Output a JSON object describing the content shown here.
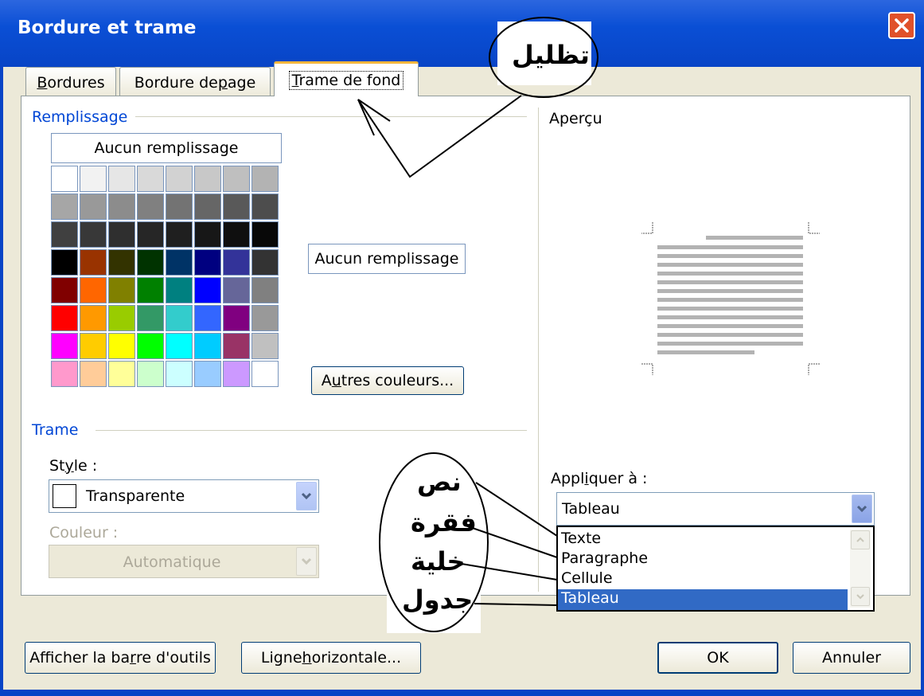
{
  "window": {
    "title": "Bordure et trame",
    "accent": "#0a4fd5",
    "close_color": "#e0512a"
  },
  "tabs": [
    {
      "label": "Bordures",
      "underline": "B",
      "rest": "ordures",
      "active": false
    },
    {
      "label": "Bordure de page",
      "before": "Bordure de ",
      "underline": "p",
      "after": "age",
      "active": false
    },
    {
      "label": "Trame de fond",
      "underline": "T",
      "rest": "rame de fond",
      "active": true
    }
  ],
  "remplissage": {
    "label": "Remplissage",
    "no_fill_box": "Aucun remplissage",
    "no_fill_button": "Aucun remplissage",
    "more_colors_before": "A",
    "more_colors_underline": "u",
    "more_colors_after": "tres couleurs...",
    "more_colors_label": "Autres couleurs...",
    "palette": [
      "#ffffff",
      "#f2f2f2",
      "#e6e6e6",
      "#d9d9d9",
      "#d2d2d2",
      "#c8c8c8",
      "#bfbfbf",
      "#b3b3b3",
      "#a6a6a6",
      "#999999",
      "#8c8c8c",
      "#808080",
      "#737373",
      "#666666",
      "#595959",
      "#4d4d4d",
      "#404040",
      "#383838",
      "#2f2f2f",
      "#262626",
      "#1f1f1f",
      "#171717",
      "#0f0f0f",
      "#080808",
      "#000000",
      "#993300",
      "#333300",
      "#003300",
      "#003366",
      "#000080",
      "#333399",
      "#333333",
      "#800000",
      "#ff6600",
      "#808000",
      "#008000",
      "#008080",
      "#0000ff",
      "#666699",
      "#808080",
      "#ff0000",
      "#ff9900",
      "#99cc00",
      "#339966",
      "#33cccc",
      "#3366ff",
      "#800080",
      "#999999",
      "#ff00ff",
      "#ffcc00",
      "#ffff00",
      "#00ff00",
      "#00ffff",
      "#00ccff",
      "#993366",
      "#c0c0c0",
      "#ff99cc",
      "#ffcc99",
      "#ffff99",
      "#ccffcc",
      "#ccffff",
      "#99ccff",
      "#cc99ff",
      "#ffffff"
    ]
  },
  "trame": {
    "label": "Trame",
    "style_label_before": "St",
    "style_label_underline": "y",
    "style_label_after": "le :",
    "style_value": "Transparente",
    "color_label": "Couleur :",
    "color_value": "Automatique"
  },
  "apercu": {
    "label": "Aperçu"
  },
  "appliquer": {
    "label_before": "Appl",
    "label_underline": "i",
    "label_after": "quer à :",
    "value": "Tableau",
    "options": [
      "Texte",
      "Paragraphe",
      "Cellule",
      "Tableau"
    ],
    "selected": "Tableau",
    "selection_color": "#316ac5"
  },
  "footer": {
    "toolbar_before": "Afficher la ba",
    "toolbar_underline": "r",
    "toolbar_after": "re d'outils",
    "horizontal_before": "Ligne ",
    "horizontal_underline": "h",
    "horizontal_after": "orizontale...",
    "ok": "OK",
    "cancel": "Annuler"
  },
  "annotations": {
    "shading": "تظليل",
    "text": "نص",
    "paragraph": "فقرة",
    "cell": "خلية",
    "table": "جدول"
  }
}
